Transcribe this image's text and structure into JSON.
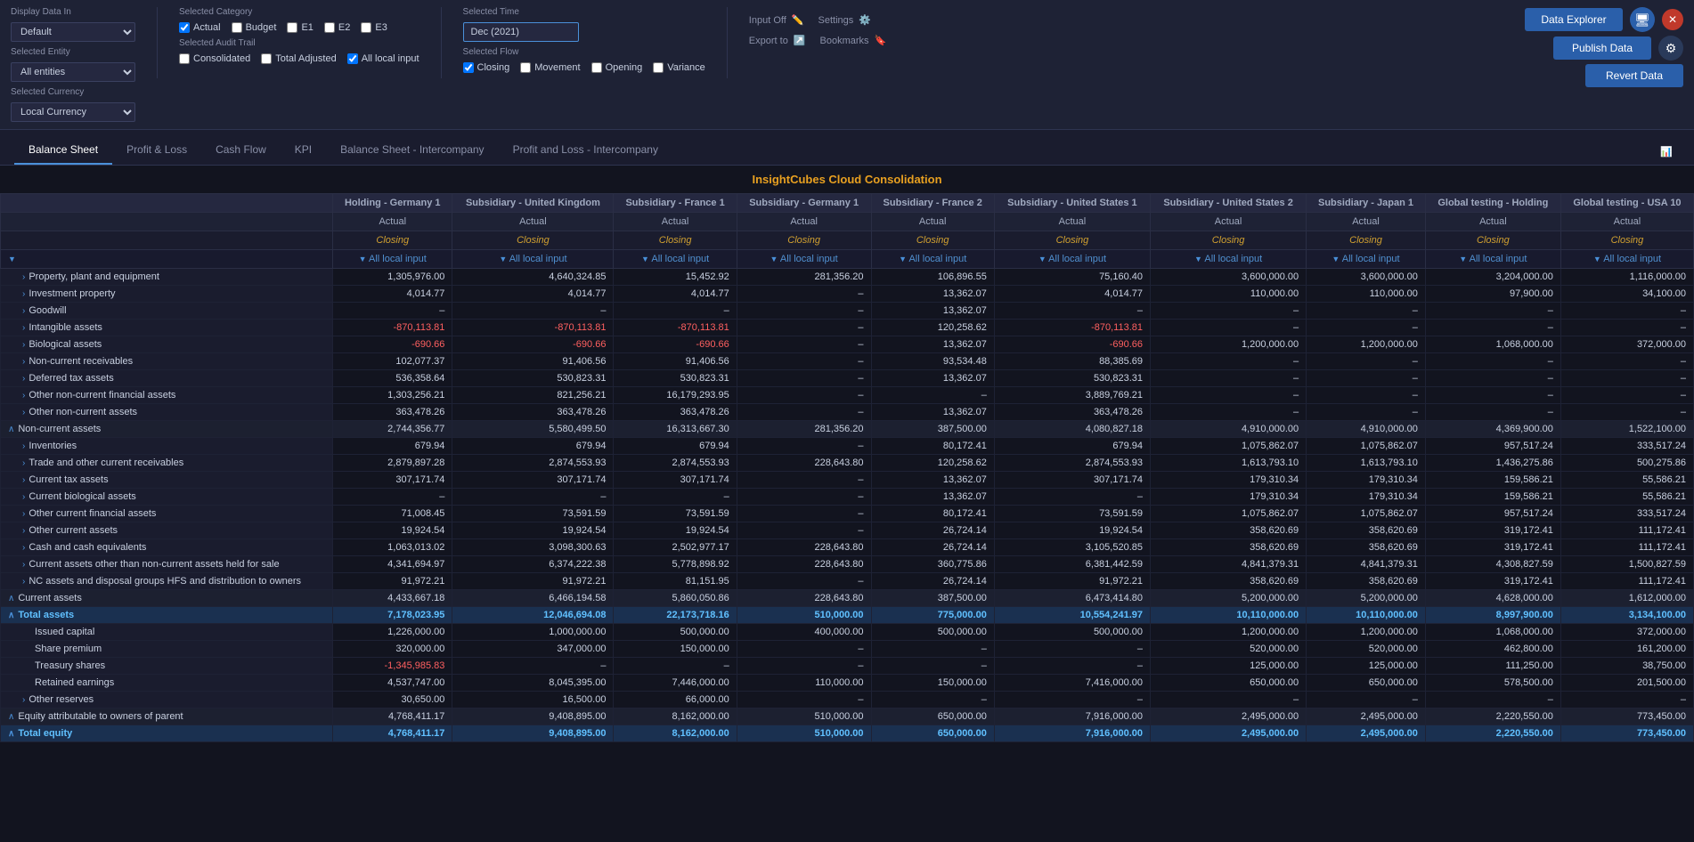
{
  "toolbar": {
    "display_data_in_label": "Display Data In",
    "display_data_in_value": "Default",
    "selected_entity_label": "Selected Entity",
    "selected_entity_value": "All entities",
    "selected_currency_label": "Selected Currency",
    "selected_currency_value": "Local Currency",
    "selected_category_label": "Selected Category",
    "categories": [
      "Actual",
      "Budget",
      "E1",
      "E2",
      "E3"
    ],
    "categories_checked": [
      true,
      false,
      false,
      false,
      false
    ],
    "selected_time_label": "Selected Time",
    "selected_time_value": "Dec (2021)",
    "selected_audit_trail_label": "Selected Audit Trail",
    "audit_trails": [
      "Consolidated",
      "Total Adjusted",
      "All local input"
    ],
    "audit_trails_checked": [
      false,
      false,
      true
    ],
    "selected_flow_label": "Selected Flow",
    "flows": [
      "Closing",
      "Movement",
      "Opening",
      "Variance"
    ],
    "flows_checked": [
      true,
      false,
      false,
      false
    ],
    "input_off_label": "Input Off",
    "settings_label": "Settings",
    "export_to_label": "Export to",
    "bookmarks_label": "Bookmarks",
    "data_explorer_btn": "Data Explorer",
    "publish_data_btn": "Publish Data",
    "revert_data_btn": "Revert Data"
  },
  "tabs": {
    "items": [
      {
        "label": "Balance Sheet",
        "active": true
      },
      {
        "label": "Profit & Loss",
        "active": false
      },
      {
        "label": "Cash Flow",
        "active": false
      },
      {
        "label": "KPI",
        "active": false
      },
      {
        "label": "Balance Sheet - Intercompany",
        "active": false
      },
      {
        "label": "Profit and Loss - Intercompany",
        "active": false
      }
    ]
  },
  "table": {
    "company_title": "InsightCubes Cloud Consolidation",
    "companies": [
      "Holding - Germany 1",
      "Subsidiary - United Kingdom",
      "Subsidiary - France 1",
      "Subsidiary - Germany 1",
      "Subsidiary - France 2",
      "Subsidiary - United States 1",
      "Subsidiary - United States 2",
      "Subsidiary - Japan 1",
      "Global testing - Holding",
      "Global testing - USA 10"
    ],
    "header_actual": "Actual",
    "header_closing": "Closing",
    "header_ali": "All local input",
    "rows": [
      {
        "label": "Property, plant and equipment",
        "indent": 1,
        "expand": true,
        "values": [
          "1,305,976.00",
          "4,640,324.85",
          "15,452.92",
          "281,356.20",
          "106,896.55",
          "75,160.40",
          "3,600,000.00",
          "3,600,000.00",
          "3,204,000.00",
          "1,116,000.00"
        ]
      },
      {
        "label": "Investment property",
        "indent": 1,
        "expand": true,
        "values": [
          "4,014.77",
          "4,014.77",
          "4,014.77",
          "–",
          "13,362.07",
          "4,014.77",
          "110,000.00",
          "110,000.00",
          "97,900.00",
          "34,100.00"
        ]
      },
      {
        "label": "Goodwill",
        "indent": 1,
        "expand": true,
        "values": [
          "–",
          "–",
          "–",
          "–",
          "13,362.07",
          "–",
          "–",
          "–",
          "–",
          "–"
        ]
      },
      {
        "label": "Intangible assets",
        "indent": 1,
        "expand": true,
        "values": [
          "-870,113.81",
          "-870,113.81",
          "-870,113.81",
          "–",
          "120,258.62",
          "-870,113.81",
          "–",
          "–",
          "–",
          "–"
        ]
      },
      {
        "label": "Biological assets",
        "indent": 1,
        "expand": true,
        "values": [
          "-690.66",
          "-690.66",
          "-690.66",
          "–",
          "13,362.07",
          "-690.66",
          "1,200,000.00",
          "1,200,000.00",
          "1,068,000.00",
          "372,000.00"
        ]
      },
      {
        "label": "Non-current receivables",
        "indent": 1,
        "expand": true,
        "values": [
          "102,077.37",
          "91,406.56",
          "91,406.56",
          "–",
          "93,534.48",
          "88,385.69",
          "–",
          "–",
          "–",
          "–"
        ]
      },
      {
        "label": "Deferred tax assets",
        "indent": 1,
        "expand": true,
        "values": [
          "536,358.64",
          "530,823.31",
          "530,823.31",
          "–",
          "13,362.07",
          "530,823.31",
          "–",
          "–",
          "–",
          "–"
        ]
      },
      {
        "label": "Other non-current financial assets",
        "indent": 1,
        "expand": true,
        "values": [
          "1,303,256.21",
          "821,256.21",
          "16,179,293.95",
          "–",
          "–",
          "3,889,769.21",
          "–",
          "–",
          "–",
          "–"
        ]
      },
      {
        "label": "Other non-current assets",
        "indent": 1,
        "expand": true,
        "values": [
          "363,478.26",
          "363,478.26",
          "363,478.26",
          "–",
          "13,362.07",
          "363,478.26",
          "–",
          "–",
          "–",
          "–"
        ]
      },
      {
        "label": "Non-current assets",
        "indent": 0,
        "expand": false,
        "subtotal": true,
        "values": [
          "2,744,356.77",
          "5,580,499.50",
          "16,313,667.30",
          "281,356.20",
          "387,500.00",
          "4,080,827.18",
          "4,910,000.00",
          "4,910,000.00",
          "4,369,900.00",
          "1,522,100.00"
        ]
      },
      {
        "label": "Inventories",
        "indent": 1,
        "expand": true,
        "values": [
          "679.94",
          "679.94",
          "679.94",
          "–",
          "80,172.41",
          "679.94",
          "1,075,862.07",
          "1,075,862.07",
          "957,517.24",
          "333,517.24"
        ]
      },
      {
        "label": "Trade and other current receivables",
        "indent": 1,
        "expand": true,
        "values": [
          "2,879,897.28",
          "2,874,553.93",
          "2,874,553.93",
          "228,643.80",
          "120,258.62",
          "2,874,553.93",
          "1,613,793.10",
          "1,613,793.10",
          "1,436,275.86",
          "500,275.86"
        ]
      },
      {
        "label": "Current tax assets",
        "indent": 1,
        "expand": true,
        "values": [
          "307,171.74",
          "307,171.74",
          "307,171.74",
          "–",
          "13,362.07",
          "307,171.74",
          "179,310.34",
          "179,310.34",
          "159,586.21",
          "55,586.21"
        ]
      },
      {
        "label": "Current biological assets",
        "indent": 1,
        "expand": true,
        "values": [
          "–",
          "–",
          "–",
          "–",
          "13,362.07",
          "–",
          "179,310.34",
          "179,310.34",
          "159,586.21",
          "55,586.21"
        ]
      },
      {
        "label": "Other current financial assets",
        "indent": 1,
        "expand": true,
        "values": [
          "71,008.45",
          "73,591.59",
          "73,591.59",
          "–",
          "80,172.41",
          "73,591.59",
          "1,075,862.07",
          "1,075,862.07",
          "957,517.24",
          "333,517.24"
        ]
      },
      {
        "label": "Other current assets",
        "indent": 1,
        "expand": true,
        "values": [
          "19,924.54",
          "19,924.54",
          "19,924.54",
          "–",
          "26,724.14",
          "19,924.54",
          "358,620.69",
          "358,620.69",
          "319,172.41",
          "111,172.41"
        ]
      },
      {
        "label": "Cash and cash equivalents",
        "indent": 1,
        "expand": true,
        "values": [
          "1,063,013.02",
          "3,098,300.63",
          "2,502,977.17",
          "228,643.80",
          "26,724.14",
          "3,105,520.85",
          "358,620.69",
          "358,620.69",
          "319,172.41",
          "111,172.41"
        ]
      },
      {
        "label": "Current assets other than non-current assets held for sale",
        "indent": 1,
        "expand": true,
        "values": [
          "4,341,694.97",
          "6,374,222.38",
          "5,778,898.92",
          "228,643.80",
          "360,775.86",
          "6,381,442.59",
          "4,841,379.31",
          "4,841,379.31",
          "4,308,827.59",
          "1,500,827.59"
        ]
      },
      {
        "label": "NC assets and disposal groups HFS and distribution to owners",
        "indent": 1,
        "expand": true,
        "values": [
          "91,972.21",
          "91,972.21",
          "81,151.95",
          "–",
          "26,724.14",
          "91,972.21",
          "358,620.69",
          "358,620.69",
          "319,172.41",
          "111,172.41"
        ]
      },
      {
        "label": "Current assets",
        "indent": 0,
        "expand": false,
        "subtotal": true,
        "values": [
          "4,433,667.18",
          "6,466,194.58",
          "5,860,050.86",
          "228,643.80",
          "387,500.00",
          "6,473,414.80",
          "5,200,000.00",
          "5,200,000.00",
          "4,628,000.00",
          "1,612,000.00"
        ]
      },
      {
        "label": "Total assets",
        "indent": 0,
        "expand": false,
        "total": true,
        "values": [
          "7,178,023.95",
          "12,046,694.08",
          "22,173,718.16",
          "510,000.00",
          "775,000.00",
          "10,554,241.97",
          "10,110,000.00",
          "10,110,000.00",
          "8,997,900.00",
          "3,134,100.00"
        ]
      },
      {
        "label": "Issued capital",
        "indent": 1,
        "values": [
          "1,226,000.00",
          "1,000,000.00",
          "500,000.00",
          "400,000.00",
          "500,000.00",
          "500,000.00",
          "1,200,000.00",
          "1,200,000.00",
          "1,068,000.00",
          "372,000.00"
        ]
      },
      {
        "label": "Share premium",
        "indent": 1,
        "values": [
          "320,000.00",
          "347,000.00",
          "150,000.00",
          "–",
          "–",
          "–",
          "520,000.00",
          "520,000.00",
          "462,800.00",
          "161,200.00"
        ]
      },
      {
        "label": "Treasury shares",
        "indent": 1,
        "values": [
          "-1,345,985.83",
          "–",
          "–",
          "–",
          "–",
          "–",
          "125,000.00",
          "125,000.00",
          "111,250.00",
          "38,750.00"
        ]
      },
      {
        "label": "Retained earnings",
        "indent": 1,
        "values": [
          "4,537,747.00",
          "8,045,395.00",
          "7,446,000.00",
          "110,000.00",
          "150,000.00",
          "7,416,000.00",
          "650,000.00",
          "650,000.00",
          "578,500.00",
          "201,500.00"
        ]
      },
      {
        "label": "Other reserves",
        "indent": 1,
        "expand": true,
        "values": [
          "30,650.00",
          "16,500.00",
          "66,000.00",
          "–",
          "–",
          "–",
          "–",
          "–",
          "–",
          "–"
        ]
      },
      {
        "label": "Equity attributable to owners of parent",
        "indent": 0,
        "expand": false,
        "subtotal": true,
        "values": [
          "4,768,411.17",
          "9,408,895.00",
          "8,162,000.00",
          "510,000.00",
          "650,000.00",
          "7,916,000.00",
          "2,495,000.00",
          "2,495,000.00",
          "2,220,550.00",
          "773,450.00"
        ]
      },
      {
        "label": "Total equity",
        "indent": 0,
        "expand": false,
        "total": true,
        "values": [
          "4,768,411.17",
          "9,408,895.00",
          "8,162,000.00",
          "510,000.00",
          "650,000.00",
          "7,916,000.00",
          "2,495,000.00",
          "2,495,000.00",
          "2,220,550.00",
          "773,450.00"
        ]
      }
    ]
  }
}
